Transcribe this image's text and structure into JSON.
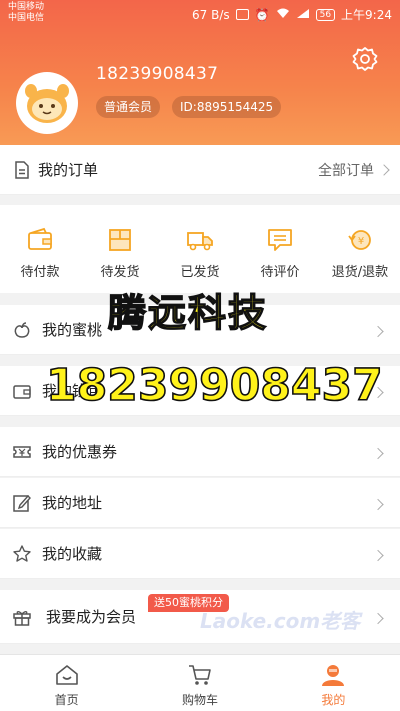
{
  "status_bar": {
    "carrier_1": "中国移动",
    "carrier_2": "中国电信",
    "speed": "67 B/s",
    "battery": "56",
    "time": "上午9:24"
  },
  "profile": {
    "phone": "18239908437",
    "level": "普通会员",
    "user_id": "ID:8895154425"
  },
  "orders": {
    "title": "我的订单",
    "all_label": "全部订单",
    "statuses": [
      {
        "label": "待付款",
        "icon": "wallet-icon"
      },
      {
        "label": "待发货",
        "icon": "package-icon"
      },
      {
        "label": "已发货",
        "icon": "truck-icon"
      },
      {
        "label": "待评价",
        "icon": "comment-icon"
      },
      {
        "label": "退货/退款",
        "icon": "refund-icon"
      }
    ]
  },
  "menu": {
    "peach_points": "我的蜜桃",
    "wallet": "我的钱包",
    "coupons": "我的优惠券",
    "address": "我的地址",
    "favorites": "我的收藏",
    "become_member": "我要成为会员",
    "promo_tag": "送50蜜桃积分"
  },
  "watermark": {
    "company": "腾远科技",
    "phone": "18239908437",
    "logo": "Laoke.com老客"
  },
  "tabbar": {
    "home": "首页",
    "cart": "购物车",
    "mine": "我的"
  },
  "colors": {
    "accent": "#f47a3a",
    "header_top": "#f3664a",
    "header_bottom": "#f89a55",
    "icon_orange": "#f5a623",
    "promo": "#f25a4a",
    "watermark_text": "#fff21a"
  }
}
